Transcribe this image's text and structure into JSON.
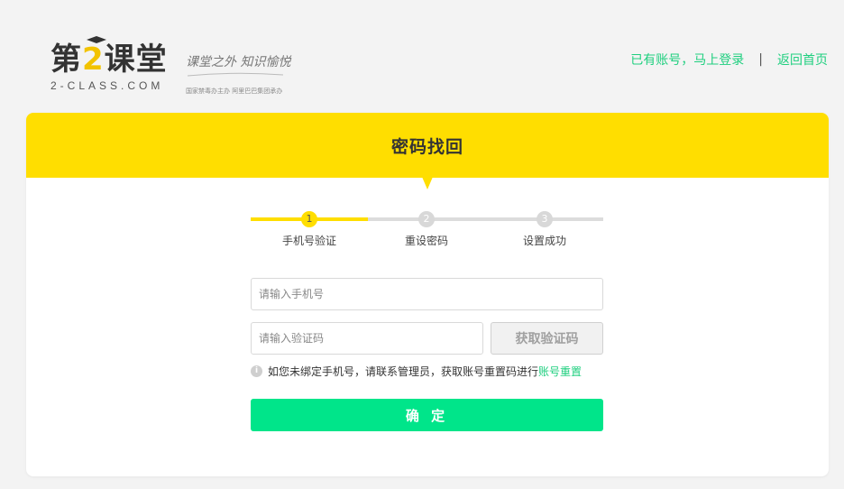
{
  "logo": {
    "main_prefix": "第",
    "main_two": "2",
    "main_suffix": "课堂",
    "sub": "2-CLASS.COM",
    "slogan": "课堂之外 知识愉悦",
    "org": "国家禁毒办主办 阿里巴巴集团承办"
  },
  "top_links": {
    "login": "已有账号，马上登录",
    "separator": "|",
    "home": "返回首页"
  },
  "card": {
    "title": "密码找回"
  },
  "steps": {
    "items": [
      {
        "num": "1",
        "label": "手机号验证",
        "active": true
      },
      {
        "num": "2",
        "label": "重设密码",
        "active": false
      },
      {
        "num": "3",
        "label": "设置成功",
        "active": false
      }
    ],
    "progress": 0.333
  },
  "form": {
    "phone_placeholder": "请输入手机号",
    "code_placeholder": "请输入验证码",
    "get_code_label": "获取验证码",
    "hint_icon": "i",
    "hint_text": "如您未绑定手机号，请联系管理员，获取账号重置码进行",
    "hint_link": "账号重置",
    "confirm_label": "确 定"
  },
  "colors": {
    "accent_yellow": "#ffde00",
    "accent_green": "#00e58a",
    "link_green": "#1fcf7f"
  }
}
